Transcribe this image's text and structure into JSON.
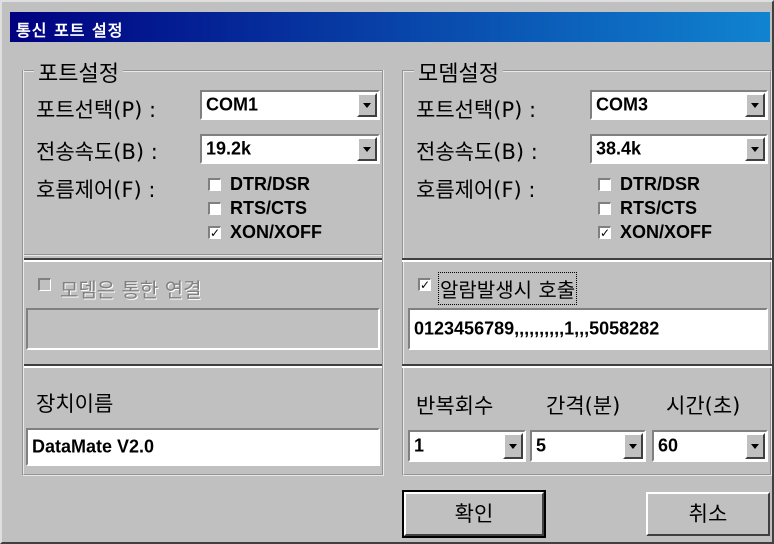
{
  "window": {
    "title": "통신 포트 설정"
  },
  "port": {
    "group_label": "포트설정",
    "select_label": "포트선택(P) :",
    "select_value": "COM1",
    "speed_label": "전송속도(B) :",
    "speed_value": "19.2k",
    "flow_label": "호름제어(F) :",
    "flow_options": [
      {
        "label": "DTR/DSR",
        "checked": false
      },
      {
        "label": "RTS/CTS",
        "checked": false
      },
      {
        "label": "XON/XOFF",
        "checked": true
      }
    ],
    "modem_connect_label": "모뎀은 통한 연결",
    "modem_connect_checked": false,
    "modem_connect_value": "",
    "device_name_label": "장치이름",
    "device_name_value": "DataMate V2.0"
  },
  "modem": {
    "group_label": "모뎀설정",
    "select_label": "포트선택(P) :",
    "select_value": "COM3",
    "speed_label": "전송속도(B) :",
    "speed_value": "38.4k",
    "flow_label": "호름제어(F) :",
    "flow_options": [
      {
        "label": "DTR/DSR",
        "checked": false
      },
      {
        "label": "RTS/CTS",
        "checked": false
      },
      {
        "label": "XON/XOFF",
        "checked": true
      }
    ],
    "alarm_call_label": "알람발생시 호출",
    "alarm_call_checked": true,
    "alarm_call_value": "0123456789,,,,,,,,,,1,,,5058282",
    "repeat_label": "반복회수",
    "repeat_value": "1",
    "interval_label": "간격(분)",
    "interval_value": "5",
    "time_label": "시간(초)",
    "time_value": "60"
  },
  "buttons": {
    "ok": "확인",
    "cancel": "취소"
  },
  "check_mark": "✓"
}
